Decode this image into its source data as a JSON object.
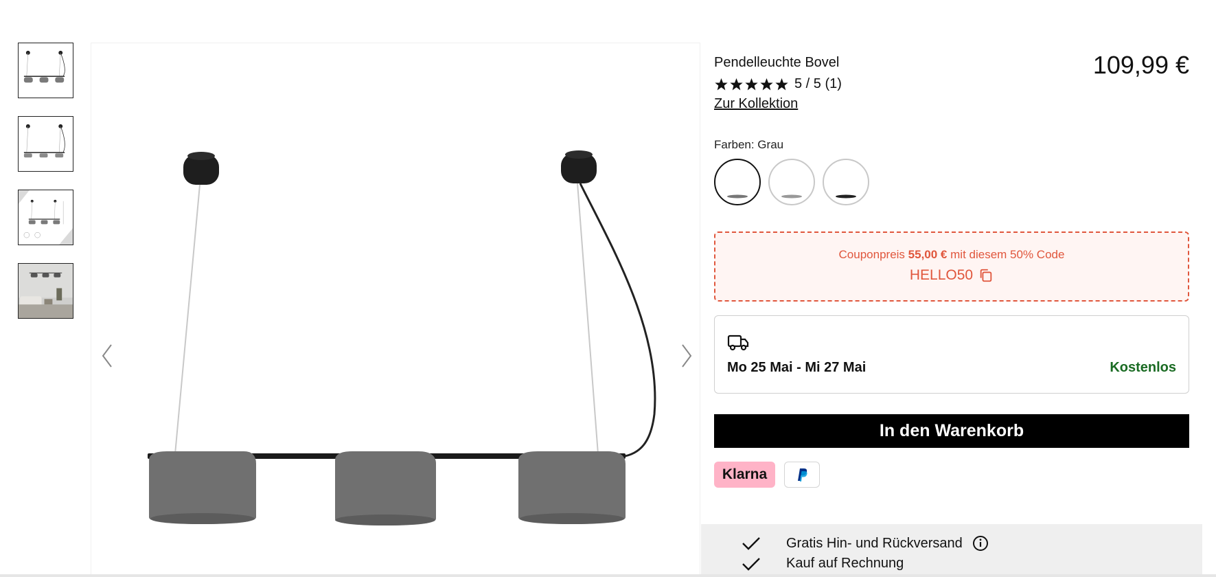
{
  "product": {
    "title": "Pendelleuchte Bovel",
    "price": "109,99 €",
    "rating": {
      "value": 5,
      "max": 5,
      "text": "5 / 5 (1)"
    },
    "collection_link": "Zur Kollektion"
  },
  "colors": {
    "label": "Farben: Grau",
    "swatches": [
      {
        "name": "Grau",
        "selected": true
      },
      {
        "name": "",
        "selected": false
      },
      {
        "name": "",
        "selected": false
      }
    ]
  },
  "coupon": {
    "prefix": "Couponpreis",
    "price": "55,00 €",
    "suffix": "mit diesem 50% Code",
    "code": "HELLO50",
    "accent": "#e0563c"
  },
  "delivery": {
    "dates": "Mo 25 Mai - Mi 27 Mai",
    "cost": "Kostenlos",
    "cost_color": "#1a6b23",
    "icon": "truck-icon"
  },
  "cart_button": "In den Warenkorb",
  "payments": {
    "klarna": "Klarna",
    "paypal_icon": "paypal-icon"
  },
  "benefits": [
    {
      "text": "Gratis Hin- und Rückversand",
      "has_info": true
    },
    {
      "text": "Kauf auf Rechnung",
      "has_info": false
    }
  ],
  "gallery": {
    "thumbnails": [
      "product-front",
      "product-front-alt",
      "product-dimensions",
      "room-scene"
    ],
    "active_index": 0
  }
}
